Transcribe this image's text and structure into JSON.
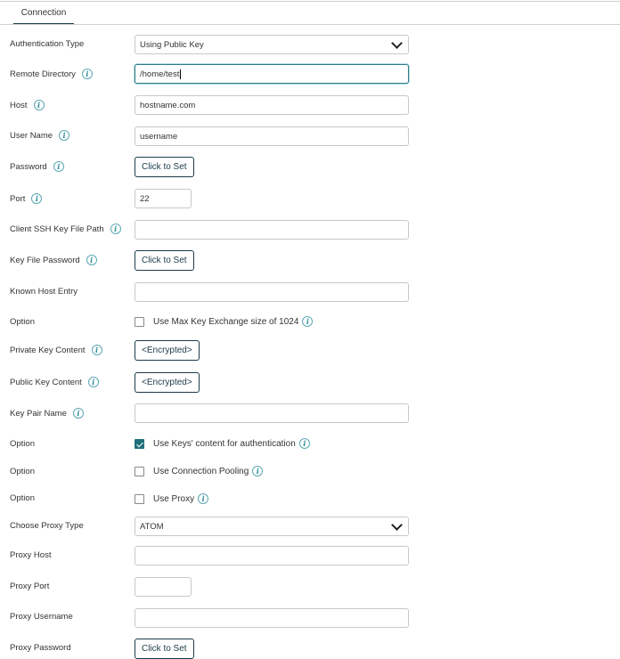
{
  "tabs": [
    {
      "label": "Connection",
      "active": true
    }
  ],
  "fields": {
    "auth_type": {
      "label": "Authentication Type",
      "value": "Using Public Key"
    },
    "remote_dir": {
      "label": "Remote Directory",
      "value": "/home/test"
    },
    "host": {
      "label": "Host",
      "value": "hostname.com"
    },
    "user_name": {
      "label": "User Name",
      "value": "username"
    },
    "password": {
      "label": "Password",
      "button": "Click to Set"
    },
    "port": {
      "label": "Port",
      "value": "22"
    },
    "client_key_path": {
      "label": "Client SSH Key File Path",
      "value": ""
    },
    "key_file_password": {
      "label": "Key File Password",
      "button": "Click to Set"
    },
    "known_host": {
      "label": "Known Host Entry",
      "value": ""
    },
    "opt_max_key": {
      "label": "Option",
      "text": "Use Max Key Exchange size of 1024",
      "checked": false
    },
    "private_key": {
      "label": "Private Key Content",
      "button": "<Encrypted>"
    },
    "public_key": {
      "label": "Public Key Content",
      "button": "<Encrypted>"
    },
    "key_pair_name": {
      "label": "Key Pair Name",
      "value": ""
    },
    "opt_keys_content": {
      "label": "Option",
      "text": "Use Keys' content for authentication",
      "checked": true
    },
    "opt_pooling": {
      "label": "Option",
      "text": "Use Connection Pooling",
      "checked": false
    },
    "opt_proxy": {
      "label": "Option",
      "text": "Use Proxy",
      "checked": false
    },
    "proxy_type": {
      "label": "Choose Proxy Type",
      "value": "ATOM"
    },
    "proxy_host": {
      "label": "Proxy Host",
      "value": ""
    },
    "proxy_port": {
      "label": "Proxy Port",
      "value": ""
    },
    "proxy_username": {
      "label": "Proxy Username",
      "value": ""
    },
    "proxy_password": {
      "label": "Proxy Password",
      "button": "Click to Set"
    }
  },
  "info_glyph": "i",
  "colors": {
    "accent": "#1b3a4b",
    "check": "#1f6f7a",
    "focus": "#2d7b86"
  }
}
